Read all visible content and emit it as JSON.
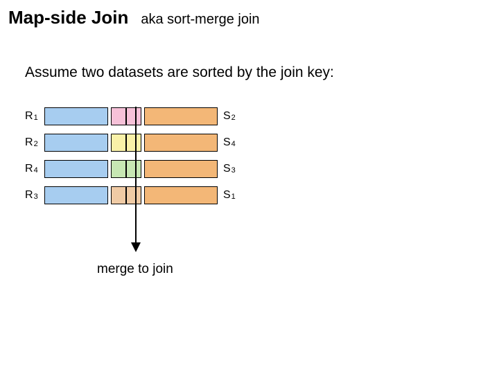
{
  "title": {
    "main": "Map-side Join",
    "sub": "aka sort-merge join"
  },
  "body": "Assume two datasets are sorted by the join key:",
  "rows": [
    {
      "r_base": "R",
      "r_sub": "1",
      "s_base": "S",
      "s_sub": "2"
    },
    {
      "r_base": "R",
      "r_sub": "2",
      "s_base": "S",
      "s_sub": "4"
    },
    {
      "r_base": "R",
      "r_sub": "4",
      "s_base": "S",
      "s_sub": "3"
    },
    {
      "r_base": "R",
      "r_sub": "3",
      "s_base": "S",
      "s_sub": "1"
    }
  ],
  "colors": {
    "left_column": "blue",
    "narrow_by_row": [
      "pink",
      "yellow",
      "green",
      "tan"
    ],
    "right_column": "orange"
  },
  "caption": "merge to join"
}
